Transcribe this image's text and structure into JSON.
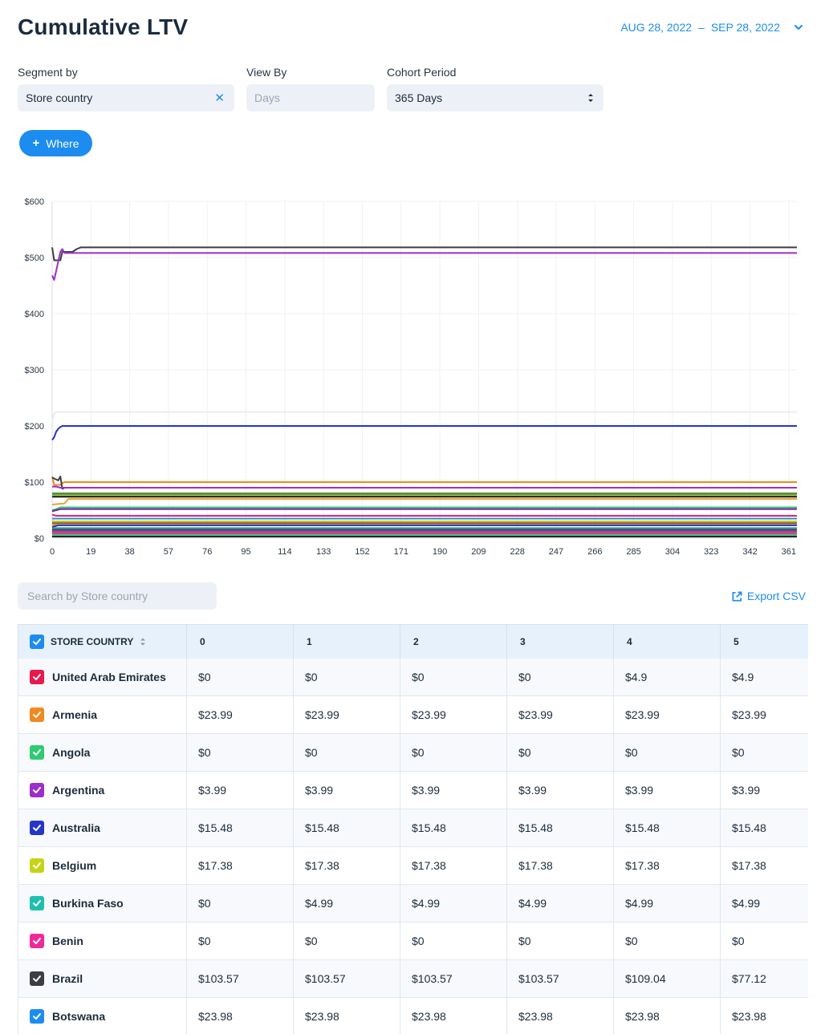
{
  "header": {
    "title": "Cumulative LTV",
    "date_start": "AUG 28, 2022",
    "date_sep": "–",
    "date_end": "SEP 28, 2022"
  },
  "filters": {
    "segment_label": "Segment by",
    "segment_value": "Store country",
    "viewby_label": "View By",
    "viewby_placeholder": "Days",
    "cohort_label": "Cohort Period",
    "cohort_value": "365 Days",
    "where_label": "Where"
  },
  "colors": {
    "accent": "#1d8cf0"
  },
  "chart_data": {
    "type": "line",
    "x_ticks": [
      0,
      19,
      38,
      57,
      76,
      95,
      114,
      133,
      152,
      171,
      190,
      209,
      228,
      247,
      266,
      285,
      304,
      323,
      342,
      361
    ],
    "y_ticks": [
      "$0",
      "$100",
      "$200",
      "$300",
      "$400",
      "$500",
      "$600"
    ],
    "xlim": [
      0,
      365
    ],
    "ylim": [
      0,
      600
    ],
    "grid": true,
    "series": [
      {
        "color": "#3d3d45",
        "points": [
          [
            0,
            518
          ],
          [
            1,
            495
          ],
          [
            4,
            495
          ],
          [
            5,
            510
          ],
          [
            10,
            510
          ],
          [
            12,
            515
          ],
          [
            14,
            518
          ],
          [
            365,
            518
          ]
        ]
      },
      {
        "color": "#9b2fc9",
        "points": [
          [
            0,
            468
          ],
          [
            1,
            460
          ],
          [
            4,
            510
          ],
          [
            5,
            515
          ],
          [
            6,
            508
          ],
          [
            365,
            508
          ]
        ]
      },
      {
        "color": "#e8ecf2",
        "points": [
          [
            0,
            210
          ],
          [
            1,
            222
          ],
          [
            2,
            225
          ],
          [
            365,
            225
          ]
        ]
      },
      {
        "color": "#2535c8",
        "points": [
          [
            0,
            175
          ],
          [
            1,
            180
          ],
          [
            2,
            190
          ],
          [
            3,
            195
          ],
          [
            4,
            198
          ],
          [
            5,
            200
          ],
          [
            365,
            200
          ]
        ]
      },
      {
        "color": "#f0891f",
        "points": [
          [
            0,
            110
          ],
          [
            1,
            95
          ],
          [
            4,
            95
          ],
          [
            5,
            98
          ],
          [
            6,
            100
          ],
          [
            365,
            100
          ]
        ]
      },
      {
        "color": "#3d3d45",
        "points": [
          [
            0,
            108
          ],
          [
            3,
            103
          ],
          [
            4,
            110
          ],
          [
            5,
            88
          ],
          [
            6,
            90
          ],
          [
            365,
            90
          ]
        ]
      },
      {
        "color": "#9b2fc9",
        "points": [
          [
            0,
            92
          ],
          [
            2,
            92
          ],
          [
            4,
            90
          ],
          [
            365,
            90
          ]
        ]
      },
      {
        "color": "#6d8a1f",
        "points": [
          [
            0,
            80
          ],
          [
            365,
            80
          ]
        ]
      },
      {
        "color": "#1c9b8e",
        "points": [
          [
            0,
            78
          ],
          [
            365,
            78
          ]
        ]
      },
      {
        "color": "#c9c31f",
        "points": [
          [
            0,
            76
          ],
          [
            365,
            76
          ]
        ]
      },
      {
        "color": "#1a1a1a",
        "points": [
          [
            0,
            74
          ],
          [
            365,
            74
          ]
        ]
      },
      {
        "color": "#e8a33a",
        "points": [
          [
            0,
            60
          ],
          [
            6,
            62
          ],
          [
            8,
            70
          ],
          [
            365,
            70
          ]
        ]
      },
      {
        "color": "#2ecc71",
        "points": [
          [
            0,
            50
          ],
          [
            2,
            52
          ],
          [
            4,
            55
          ],
          [
            365,
            55
          ]
        ]
      },
      {
        "color": "#7a1fa8",
        "points": [
          [
            0,
            48
          ],
          [
            2,
            50
          ],
          [
            4,
            52
          ],
          [
            365,
            52
          ]
        ]
      },
      {
        "color": "#e81f6a",
        "points": [
          [
            0,
            42
          ],
          [
            2,
            40
          ],
          [
            365,
            40
          ]
        ]
      },
      {
        "color": "#1f8fd6",
        "points": [
          [
            0,
            35
          ],
          [
            365,
            35
          ]
        ]
      },
      {
        "color": "#c9c31f",
        "points": [
          [
            0,
            30
          ],
          [
            365,
            30
          ]
        ]
      },
      {
        "color": "#8b5a2b",
        "points": [
          [
            0,
            27
          ],
          [
            365,
            27
          ]
        ]
      },
      {
        "color": "#f0891f",
        "points": [
          [
            0,
            24
          ],
          [
            365,
            24
          ]
        ]
      },
      {
        "color": "#2535c8",
        "points": [
          [
            0,
            20
          ],
          [
            3,
            23
          ],
          [
            365,
            23
          ]
        ]
      },
      {
        "color": "#1c9b8e",
        "points": [
          [
            0,
            18
          ],
          [
            365,
            18
          ]
        ]
      },
      {
        "color": "#3d3d45",
        "points": [
          [
            0,
            15
          ],
          [
            365,
            15
          ]
        ]
      },
      {
        "color": "#9b2fc9",
        "points": [
          [
            0,
            12
          ],
          [
            365,
            12
          ]
        ]
      },
      {
        "color": "#e81f6a",
        "points": [
          [
            0,
            9
          ],
          [
            365,
            9
          ]
        ]
      },
      {
        "color": "#2ecc71",
        "points": [
          [
            0,
            6
          ],
          [
            365,
            6
          ]
        ]
      },
      {
        "color": "#1a1a1a",
        "points": [
          [
            0,
            3
          ],
          [
            365,
            3
          ]
        ]
      }
    ]
  },
  "table_toolbar": {
    "search_placeholder": "Search by Store country",
    "export_label": "Export CSV"
  },
  "table": {
    "headers": [
      "STORE COUNTRY",
      "0",
      "1",
      "2",
      "3",
      "4",
      "5"
    ],
    "rows": [
      {
        "country": "United Arab Emirates",
        "color": "#e8194b",
        "values": [
          "$0",
          "$0",
          "$0",
          "$0",
          "$4.9",
          "$4.9"
        ]
      },
      {
        "country": "Armenia",
        "color": "#f0891f",
        "values": [
          "$23.99",
          "$23.99",
          "$23.99",
          "$23.99",
          "$23.99",
          "$23.99"
        ]
      },
      {
        "country": "Angola",
        "color": "#2ecc71",
        "values": [
          "$0",
          "$0",
          "$0",
          "$0",
          "$0",
          "$0"
        ]
      },
      {
        "country": "Argentina",
        "color": "#9b2fc9",
        "values": [
          "$3.99",
          "$3.99",
          "$3.99",
          "$3.99",
          "$3.99",
          "$3.99"
        ]
      },
      {
        "country": "Australia",
        "color": "#2535c8",
        "values": [
          "$15.48",
          "$15.48",
          "$15.48",
          "$15.48",
          "$15.48",
          "$15.48"
        ]
      },
      {
        "country": "Belgium",
        "color": "#c6d418",
        "values": [
          "$17.38",
          "$17.38",
          "$17.38",
          "$17.38",
          "$17.38",
          "$17.38"
        ]
      },
      {
        "country": "Burkina Faso",
        "color": "#1fbfb0",
        "values": [
          "$0",
          "$4.99",
          "$4.99",
          "$4.99",
          "$4.99",
          "$4.99"
        ]
      },
      {
        "country": "Benin",
        "color": "#f0299a",
        "values": [
          "$0",
          "$0",
          "$0",
          "$0",
          "$0",
          "$0"
        ]
      },
      {
        "country": "Brazil",
        "color": "#3d3d45",
        "values": [
          "$103.57",
          "$103.57",
          "$103.57",
          "$103.57",
          "$109.04",
          "$77.12"
        ]
      },
      {
        "country": "Botswana",
        "color": "#1d8cf0",
        "values": [
          "$23.98",
          "$23.98",
          "$23.98",
          "$23.98",
          "$23.98",
          "$23.98"
        ]
      }
    ]
  }
}
